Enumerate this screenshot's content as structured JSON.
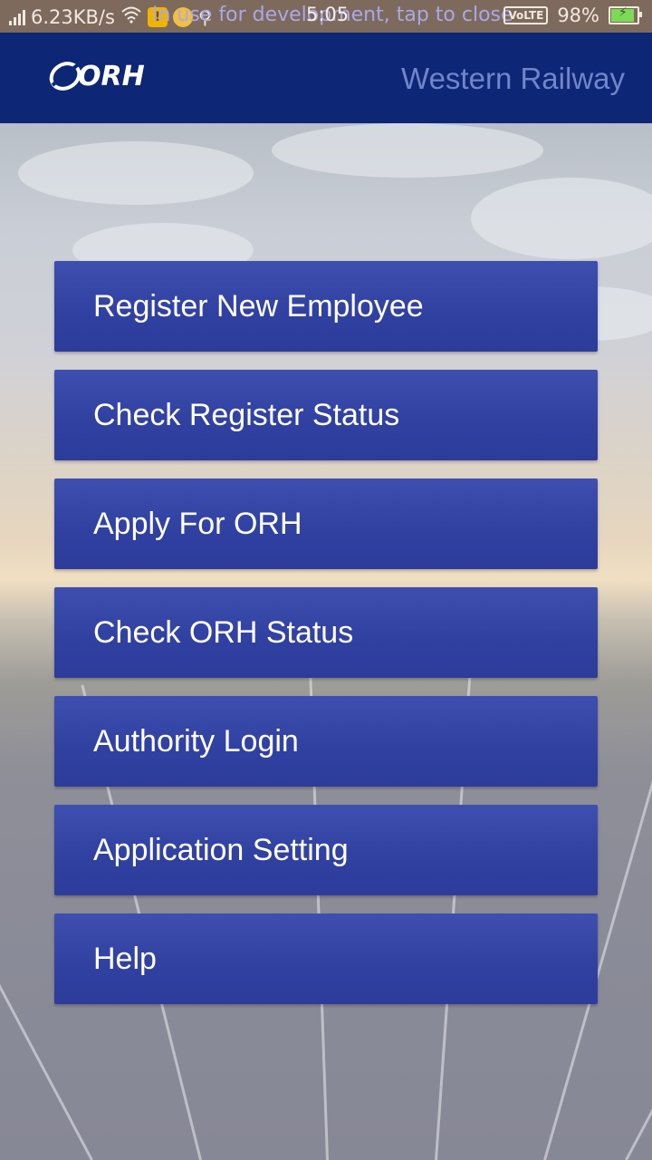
{
  "status_bar": {
    "network_speed": "6.23KB/s",
    "notification_text": "In use for development, tap to close",
    "time": "5:05",
    "volte": "VoLTE",
    "battery": "98%",
    "battery_level": 0.98
  },
  "app_bar": {
    "logo_text": "ORH",
    "title": "Western Railway"
  },
  "menu": {
    "items": [
      {
        "label": "Register New Employee"
      },
      {
        "label": "Check Register Status"
      },
      {
        "label": "Apply For ORH"
      },
      {
        "label": "Check ORH Status"
      },
      {
        "label": "Authority Login"
      },
      {
        "label": "Application Setting"
      },
      {
        "label": "Help"
      }
    ]
  },
  "colors": {
    "app_bar": "#0d2676",
    "button": "#3141a2",
    "title_text": "#6f86c9",
    "status_bar": "#7d6a5c"
  }
}
